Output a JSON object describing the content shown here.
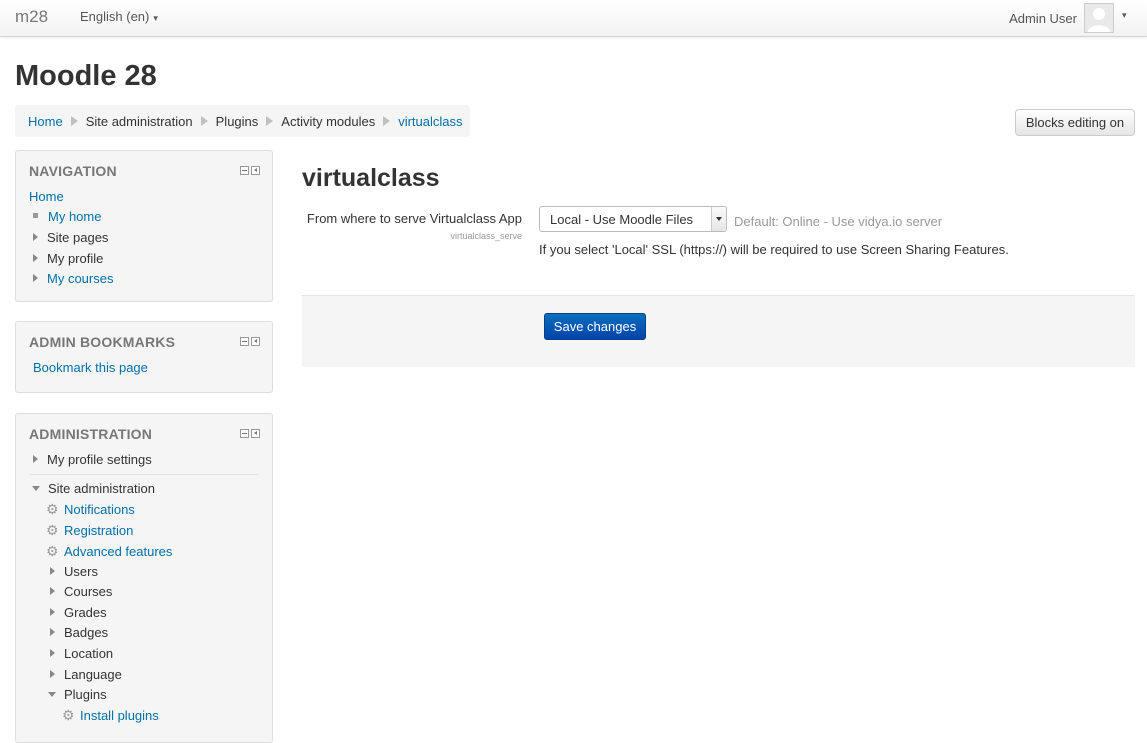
{
  "navbar": {
    "brand": "m28",
    "language": "English (en)",
    "user_name": "Admin User"
  },
  "header": {
    "site_title": "Moodle 28",
    "blocks_editing_button": "Blocks editing on"
  },
  "breadcrumb": [
    "Home",
    "Site administration",
    "Plugins",
    "Activity modules",
    "virtualclass"
  ],
  "navigation_block": {
    "title": "NAVIGATION",
    "home": "Home",
    "items": [
      "My home",
      "Site pages",
      "My profile",
      "My courses"
    ]
  },
  "bookmarks_block": {
    "title": "ADMIN BOOKMARKS",
    "link": "Bookmark this page"
  },
  "admin_block": {
    "title": "ADMINISTRATION",
    "profile_settings": "My profile settings",
    "site_admin": "Site administration",
    "gear_items": [
      "Notifications",
      "Registration",
      "Advanced features"
    ],
    "sub_items": [
      "Users",
      "Courses",
      "Grades",
      "Badges",
      "Location",
      "Language",
      "Plugins"
    ],
    "plugins_first_child": "Install plugins"
  },
  "main": {
    "heading": "virtualclass",
    "setting_label": "From where to serve Virtualclass App",
    "setting_key": "virtualclass_serve",
    "select_value": "Local - Use Moodle Files",
    "default_text": "Default: Online - Use vidya.io server",
    "description": "If you select 'Local' SSL (https://) will be required to use Screen Sharing Features.",
    "save_button": "Save changes"
  }
}
